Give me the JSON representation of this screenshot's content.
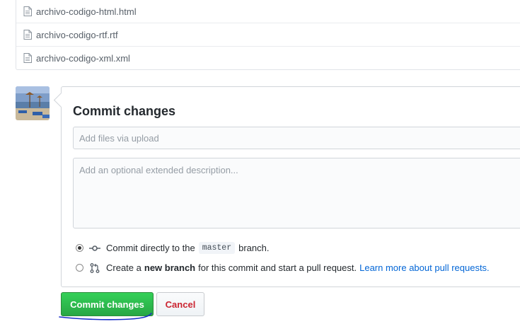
{
  "files": [
    {
      "name": "archivo-codigo-html.html",
      "icon": "file-icon"
    },
    {
      "name": "archivo-codigo-rtf.rtf",
      "icon": "file-icon"
    },
    {
      "name": "archivo-codigo-xml.xml",
      "icon": "file-icon"
    }
  ],
  "commit": {
    "title": "Commit changes",
    "summary_placeholder": "Add files via upload",
    "summary_value": "",
    "description_placeholder": "Add an optional extended description...",
    "description_value": "",
    "options": [
      {
        "selected": true,
        "icon": "git-commit-icon",
        "text_before": "Commit directly to the",
        "branch": "master",
        "text_after": "branch."
      },
      {
        "selected": false,
        "icon": "git-pull-request-icon",
        "text_before": "Create a",
        "bold": "new branch",
        "text_after": "for this commit and start a pull request.",
        "link": "Learn more about pull requests."
      }
    ],
    "submit_label": "Commit changes",
    "cancel_label": "Cancel"
  },
  "colors": {
    "primary_button": "#28a745",
    "cancel_text": "#cb2431",
    "link": "#0366d6",
    "annotation_ink": "#1a2ec9"
  }
}
